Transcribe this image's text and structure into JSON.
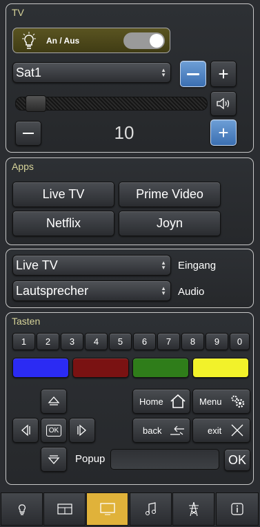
{
  "tv": {
    "title": "TV",
    "power_label": "An / Aus",
    "channel_value": "Sat1",
    "volume_value": "10"
  },
  "apps": {
    "title": "Apps",
    "buttons": [
      "Live TV",
      "Prime Video",
      "Netflix",
      "Joyn"
    ]
  },
  "io": {
    "input_value": "Live TV",
    "input_label": "Eingang",
    "audio_value": "Lautsprecher",
    "audio_label": "Audio"
  },
  "keys": {
    "title": "Tasten",
    "numbers": [
      "1",
      "2",
      "3",
      "4",
      "5",
      "6",
      "7",
      "8",
      "9",
      "0"
    ],
    "colors": [
      "#2b2bf3",
      "#7a1212",
      "#2f7d1a",
      "#f2f22a"
    ],
    "ok_label": "OK",
    "home_label": "Home",
    "menu_label": "Menu",
    "back_label": "back",
    "exit_label": "exit",
    "popup_label": "Popup",
    "popup_ok": "OK"
  },
  "accent": "#e0b23a",
  "tabs": [
    "bulb-icon",
    "window-icon",
    "tv-icon",
    "music-icon",
    "power-tower-icon",
    "info-icon"
  ]
}
